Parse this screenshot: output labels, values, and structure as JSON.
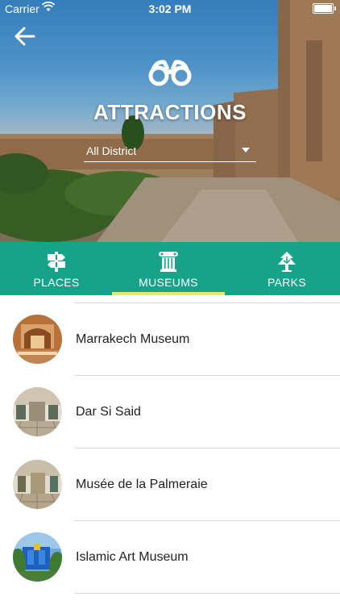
{
  "status_bar": {
    "carrier": "Carrier",
    "time": "3:02 PM"
  },
  "header": {
    "title": "ATTRACTIONS",
    "district_select": {
      "value": "All District"
    }
  },
  "tabs": [
    {
      "label": "PLACES",
      "icon": "signpost-icon",
      "active": false
    },
    {
      "label": "MUSEUMS",
      "icon": "museum-column-icon",
      "active": true
    },
    {
      "label": "PARKS",
      "icon": "tree-icon",
      "active": false
    }
  ],
  "colors": {
    "tab_bar": "#17a28a",
    "active_indicator": "#f4e56b",
    "text": "#222222",
    "divider": "#d9d9d9"
  },
  "items": [
    {
      "name": "Marrakech Museum"
    },
    {
      "name": "Dar Si Said"
    },
    {
      "name": "Musée de la Palmeraie"
    },
    {
      "name": "Islamic Art Museum"
    }
  ]
}
